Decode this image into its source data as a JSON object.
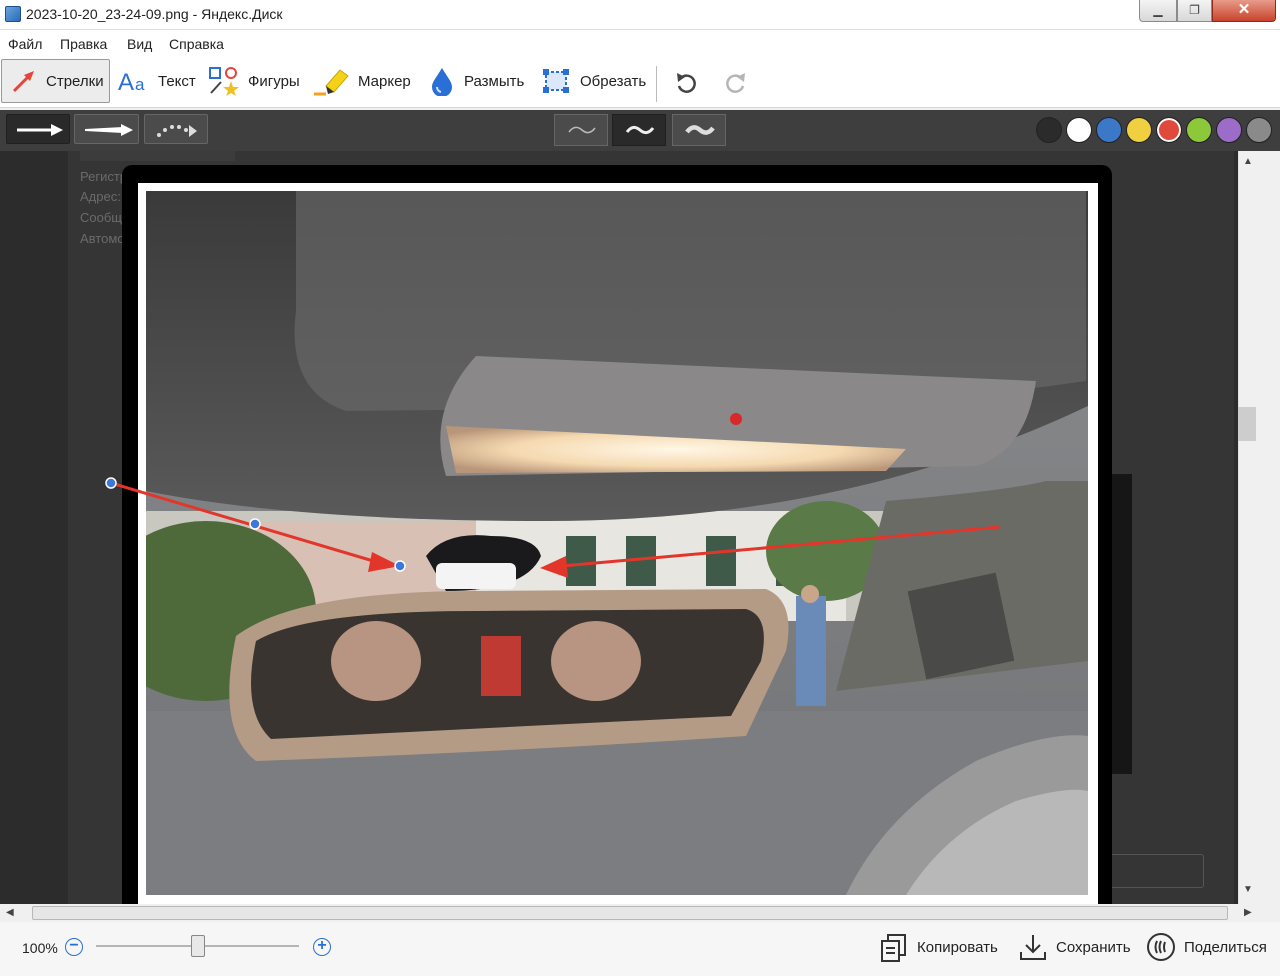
{
  "window": {
    "title": "2023-10-20_23-24-09.png - Яндекс.Диск",
    "min_label": "▁",
    "max_label": "❐",
    "close_label": "✕"
  },
  "menu": [
    "Файл",
    "Правка",
    "Вид",
    "Справка"
  ],
  "tools": [
    {
      "label": "Стрелки",
      "icon": "arrow-tool-icon",
      "active": true
    },
    {
      "label": "Текст",
      "icon": "text-tool-icon"
    },
    {
      "label": "Фигуры",
      "icon": "shapes-tool-icon"
    },
    {
      "label": "Маркер",
      "icon": "marker-tool-icon"
    },
    {
      "label": "Размыть",
      "icon": "blur-tool-icon"
    },
    {
      "label": "Обрезать",
      "icon": "crop-tool-icon"
    }
  ],
  "history": {
    "undo_icon": "undo-icon",
    "redo_icon": "redo-icon"
  },
  "arrow_styles": [
    "arrow-solid-icon",
    "arrow-thin-icon",
    "arrow-dotted-icon"
  ],
  "line_widths": [
    "thin",
    "medium",
    "thick"
  ],
  "colors": [
    {
      "name": "black",
      "hex": "#2b2b2b"
    },
    {
      "name": "white",
      "hex": "#ffffff"
    },
    {
      "name": "blue",
      "hex": "#3b78c8"
    },
    {
      "name": "yellow",
      "hex": "#f0d040"
    },
    {
      "name": "red",
      "hex": "#e04a3c",
      "selected": true
    },
    {
      "name": "green",
      "hex": "#8cc83a"
    },
    {
      "name": "purple",
      "hex": "#9b6cc8"
    },
    {
      "name": "gray",
      "hex": "#8a8a8a"
    }
  ],
  "background_doc_lines": [
    "Регистр",
    "Адрес:",
    "Сообщ",
    "Автомо"
  ],
  "annotation_color": "#e2362b",
  "status": {
    "zoom": "100%",
    "zoom_out": "−",
    "zoom_in": "+",
    "copy_label": "Копировать",
    "save_label": "Сохранить",
    "share_label": "Поделиться"
  }
}
